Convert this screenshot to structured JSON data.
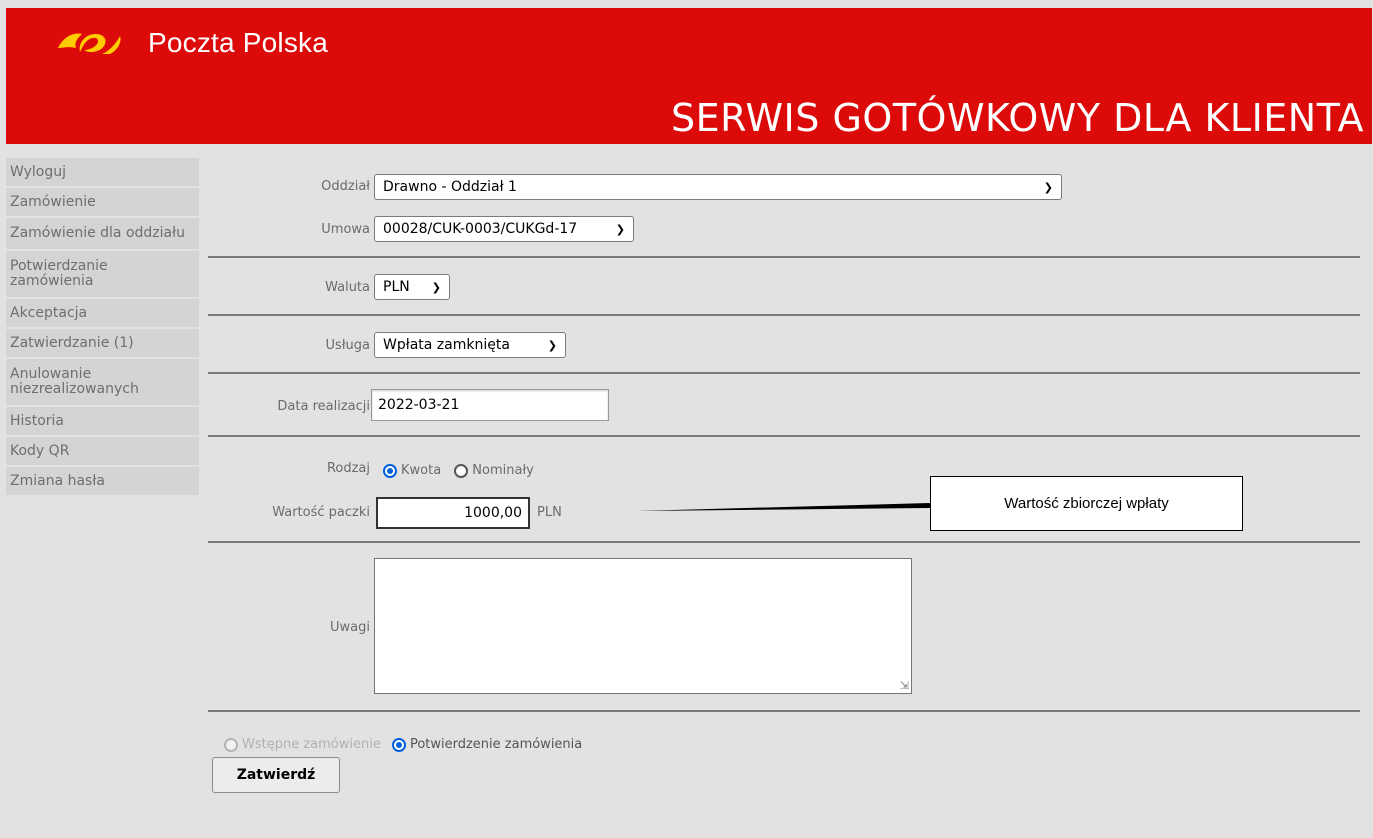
{
  "header": {
    "brand": "Poczta Polska",
    "title": "SERWIS GOTÓWKOWY DLA KLIENTA"
  },
  "sidebar": {
    "items": [
      {
        "label": "Wyloguj"
      },
      {
        "label": "Zamówienie"
      },
      {
        "label": "Zamówienie dla oddziału"
      },
      {
        "label": "Potwierdzanie zamówienia"
      },
      {
        "label": "Akceptacja"
      },
      {
        "label": "Zatwierdzanie (1)"
      },
      {
        "label": "Anulowanie niezrealizowanych"
      },
      {
        "label": "Historia"
      },
      {
        "label": "Kody QR"
      },
      {
        "label": "Zmiana hasła"
      }
    ]
  },
  "form": {
    "oddzial": {
      "label": "Oddział",
      "value": "Drawno - Oddział 1"
    },
    "umowa": {
      "label": "Umowa",
      "value": "00028/CUK-0003/CUKGd-17"
    },
    "waluta": {
      "label": "Waluta",
      "value": "PLN"
    },
    "usluga": {
      "label": "Usługa",
      "value": "Wpłata zamknięta"
    },
    "data_realizacji": {
      "label": "Data realizacji",
      "value": "2022-03-21"
    },
    "rodzaj": {
      "label": "Rodzaj",
      "options": [
        {
          "label": "Kwota",
          "checked": true
        },
        {
          "label": "Nominały",
          "checked": false
        }
      ]
    },
    "wartosc_paczki": {
      "label": "Wartość paczki",
      "value": "1000,00",
      "unit": "PLN"
    },
    "uwagi": {
      "label": "Uwagi",
      "value": ""
    },
    "typ": {
      "options": [
        {
          "label": "Wstępne zamówienie",
          "checked": false,
          "disabled": true
        },
        {
          "label": "Potwierdzenie zamówienia",
          "checked": true,
          "disabled": false
        }
      ]
    },
    "submit_label": "Zatwierdź"
  },
  "annotation": {
    "text": "Wartość zbiorczej wpłaty"
  },
  "colors": {
    "header_red": "#dd0a0a",
    "logo_yellow": "#ffcc00",
    "radio_blue": "#0060df",
    "background": "#e2e2e2",
    "sidebar_bg": "#d4d4d4"
  }
}
